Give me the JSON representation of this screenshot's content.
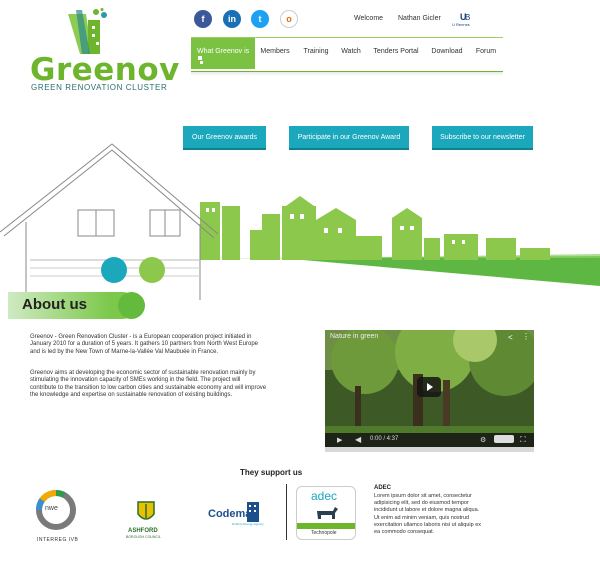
{
  "brand": {
    "name": "Greenov",
    "tagline": "GREEN RENOVATION CLUSTER",
    "colors": {
      "green": "#6cb52d",
      "teal": "#1ba8bc",
      "light_green": "#7bc142"
    }
  },
  "social": [
    {
      "icon": "facebook-icon",
      "glyph": "f"
    },
    {
      "icon": "linkedin-icon",
      "glyph": "in"
    },
    {
      "icon": "twitter-icon",
      "glyph": "t"
    },
    {
      "icon": "other-social-icon",
      "glyph": "o"
    }
  ],
  "topbar": {
    "welcome": "Welcome",
    "user": "Nathan Gicler",
    "partner_logo_text": "U Rennes"
  },
  "nav": {
    "items": [
      "What Greenov is",
      "Members",
      "Training",
      "Watch",
      "Tenders Portal",
      "Download",
      "Forum"
    ]
  },
  "actions": {
    "awards": "Our Greenov awards",
    "participate": "Participate in our Greenov Award",
    "newsletter": "Subscribe to our newsletter"
  },
  "about": {
    "title": "About us",
    "para1": "Greenov - Green Renovation Cluster - is a European cooperation project initiated in January 2010 for a duration of 5 years. It gathers 10 partners from North West Europe and is led by the New Town of Marne-la-Vallée Val Maubuée in France.",
    "para2": "Greenov aims at developing the economic sector of sustainable renovation mainly by stimulating the innovation capacity of SMEs working in the field. The project will contribute to the transition to low carbon cities and sustainable economy and will improve the knowledge and expertise on sustainable renovation of existing buildings."
  },
  "video": {
    "title": "Nature in green",
    "time": "0:00 / 4:37"
  },
  "support": {
    "title": "They support us",
    "logos": {
      "nwe": "nwe",
      "interreg": "INTERREG IVB",
      "ashford": "ASHFORD",
      "ashford_sub": "BOROUGH COUNCIL",
      "codema": "Codema",
      "codema_sub": "Dublin's Energy Agency",
      "adec": "adec",
      "adec_sub": "Technopole"
    },
    "adec_title": "ADEC",
    "adec_text": "Lorem ipsum dolor sit amet, consectetur adipisicing elit, sed do eiusmod tempor incididunt ut labore et dolore magna aliqua. Ut enim ad minim veniam, quis nostrud exercitation ullamco laboris nisi ut aliquip ex ea commodo consequat."
  }
}
